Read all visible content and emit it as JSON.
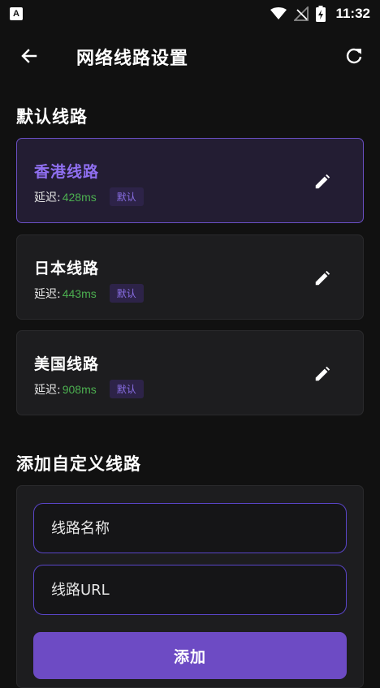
{
  "statusbar": {
    "app_icon_letter": "A",
    "time": "11:32"
  },
  "appbar": {
    "title": "网络线路设置"
  },
  "default_section": {
    "title": "默认线路",
    "routes": [
      {
        "name": "香港线路",
        "latency_label": "延迟:",
        "latency_value": "428ms",
        "badge": "默认",
        "selected": true
      },
      {
        "name": "日本线路",
        "latency_label": "延迟:",
        "latency_value": "443ms",
        "badge": "默认",
        "selected": false
      },
      {
        "name": "美国线路",
        "latency_label": "延迟:",
        "latency_value": "908ms",
        "badge": "默认",
        "selected": false
      }
    ]
  },
  "custom_section": {
    "title": "添加自定义线路",
    "name_placeholder": "线路名称",
    "url_placeholder": "线路URL",
    "add_label": "添加"
  },
  "colors": {
    "background": "#111111",
    "card": "#1d1d1f",
    "accent": "#6d4bc4",
    "accent_text": "#8f6ff0",
    "latency_green": "#4caf50"
  },
  "icons": {
    "back": "arrow-left-icon",
    "refresh": "refresh-icon",
    "edit": "pencil-icon",
    "wifi": "wifi-icon",
    "signal": "signal-off-icon",
    "battery": "battery-charging-icon"
  }
}
